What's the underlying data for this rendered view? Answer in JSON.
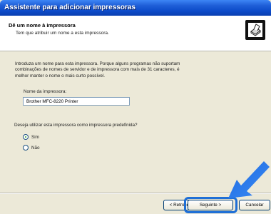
{
  "window": {
    "title": "Assistente para adicionar impressoras"
  },
  "header": {
    "title": "Dê um nome à impressora",
    "subtitle": "Tem que atribuir um nome a esta impressora.",
    "icon": "printer-icon"
  },
  "content": {
    "instruction_lines": [
      "Introduza um nome para esta impressora. Porque alguns programas não suportam",
      "combinações de nomes de servidor e de impressora com mais de 31 caracteres, é",
      "melhor manter o nome o mais curto possível."
    ],
    "field_label": "Nome da impressora:",
    "printer_name": "Brother MFC-8220 Printer",
    "default_question": "Deseja utilizar esta impressora como impressora predefinida?",
    "options": [
      {
        "label": "Sim",
        "selected": true
      },
      {
        "label": "Não",
        "selected": false
      }
    ]
  },
  "buttons": {
    "back": "< Retroceder",
    "next": "Seguinte >",
    "cancel": "Cancelar"
  },
  "colors": {
    "titlebar": "#0c4bc9",
    "highlight": "#1f6fd6"
  }
}
